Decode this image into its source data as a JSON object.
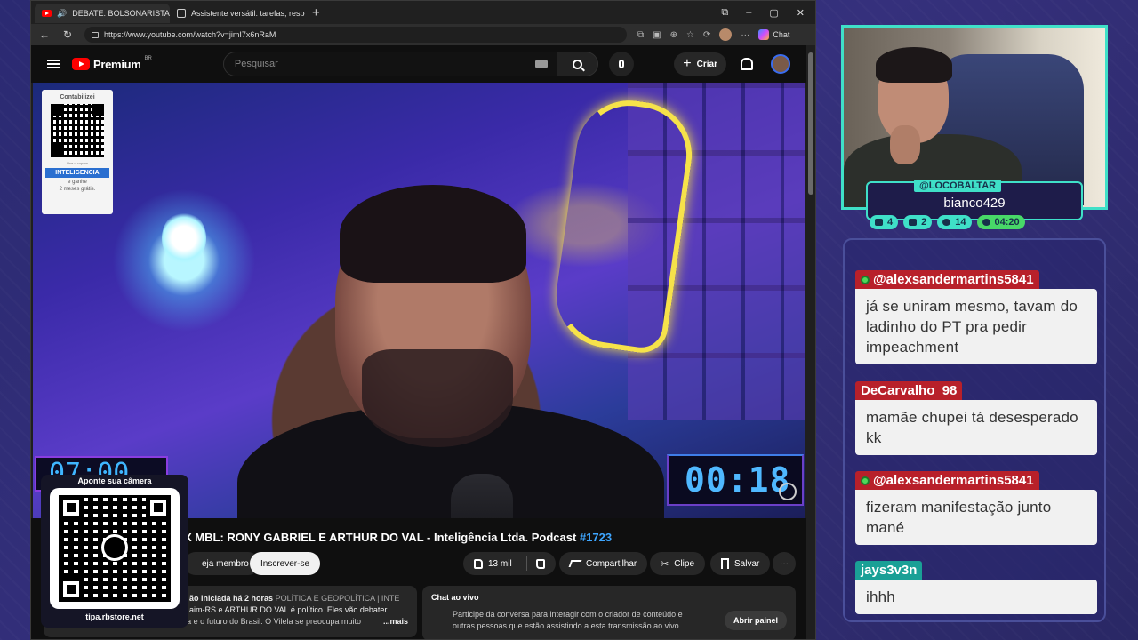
{
  "browser": {
    "tabs": [
      {
        "title": "DEBATE: BOLSONARISTA X MBL",
        "active": true
      },
      {
        "title": "Assistente versátil: tarefas, respostas",
        "active": false
      }
    ],
    "url": "https://www.youtube.com/watch?v=jimI7x6nRaM",
    "chat_label": "Chat"
  },
  "youtube": {
    "logo": "Premium",
    "logo_country": "BR",
    "search_placeholder": "Pesquisar",
    "create_label": "Criar"
  },
  "video": {
    "promo_card": {
      "title": "Contabilizei",
      "small": "Use o cupom",
      "code": "INTELIGENCIA",
      "sub": "e ganhe",
      "sub2": "2 meses grátis."
    },
    "clock_left": "07:00",
    "clock_right": "00:18"
  },
  "below": {
    "title": "X MBL: RONY GABRIEL E ARTHUR DO VAL - Inteligência Ltda. Podcast",
    "title_tag": "#1723",
    "join_label": "eja membro",
    "subscribe_label": "Inscrever-se",
    "likes": "13 mil",
    "share_label": "Compartilhar",
    "clip_label": "Clipe",
    "save_label": "Salvar",
    "desc_meta": "ão iniciada há 2 horas",
    "desc_category": "POLÍTICA E GEOPOLÍTICA | INTE",
    "desc_line2": "aim-RS e ARTHUR DO VAL é político. Eles vão debater",
    "desc_line3": "sobre Bolsonaro, a política de direita e o futuro do Brasil. O Vilela se preocupa muito",
    "desc_more": "...mais",
    "chat_title": "Chat ao vivo",
    "chat_text": "Participe da conversa para interagir com o criador de conteúdo e outras pessoas que estão assistindo a esta transmissão ao vivo.",
    "chat_open": "Abrir painel"
  },
  "qr_overlay": {
    "title": "Aponte sua câmera",
    "site": "tipa.rbstore.net"
  },
  "streamer": {
    "handle": "@LOCOBALTAR",
    "user": "bianco429",
    "stats": [
      "4",
      "2",
      "14",
      "04:20"
    ]
  },
  "chat": [
    {
      "user": "@alexsandermartins5841",
      "text": "já se uniram mesmo, tavam do ladinho do PT pra pedir impeachment",
      "color": "#b8202a",
      "badge": true
    },
    {
      "user": "DeCarvalho_98",
      "text": "mamãe chupei tá desesperado kk",
      "color": "#b8202a",
      "badge": false
    },
    {
      "user": "@alexsandermartins5841",
      "text": "fizeram manifestação junto mané",
      "color": "#b8202a",
      "badge": true
    },
    {
      "user": "jays3v3n",
      "text": "ihhh",
      "color": "#1aa096",
      "badge": false
    }
  ]
}
